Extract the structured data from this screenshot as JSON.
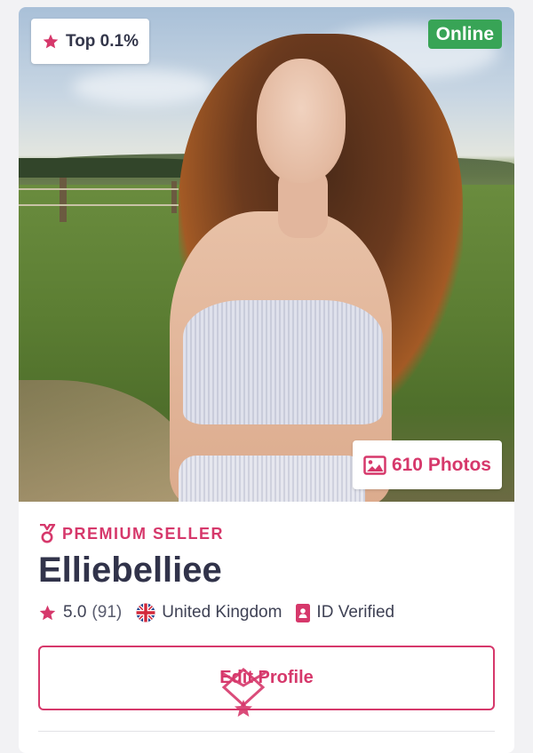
{
  "profile": {
    "rank_badge": "Top 0.1%",
    "status": "Online",
    "photos_label": "610 Photos",
    "seller_tier": "PREMIUM SELLER",
    "name": "Elliebelliee",
    "rating": "5.0",
    "rating_count": "(91)",
    "country": "United Kingdom",
    "verification": "ID Verified"
  },
  "actions": {
    "edit_label": "Edit Profile"
  },
  "colors": {
    "accent": "#d6386b",
    "online": "#38a456",
    "text": "#31334a"
  },
  "icons": {
    "rank": "star-icon",
    "photos": "image-icon",
    "seller": "medal-icon",
    "rating": "star-icon",
    "country": "uk-flag-icon",
    "verified": "id-card-icon"
  }
}
